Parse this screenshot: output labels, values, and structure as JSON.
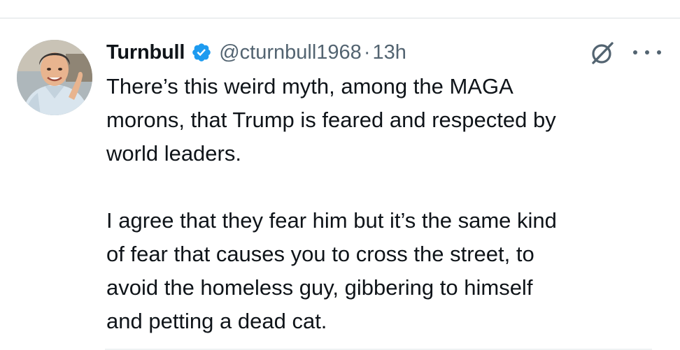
{
  "tweet": {
    "author": {
      "display_name": "Turnbull",
      "handle": "@cturnbull1968",
      "verified": true,
      "verified_color": "#1d9bf0"
    },
    "separator": "·",
    "timestamp": "13h",
    "paragraphs": [
      [
        "There’s this weird myth, among the MAGA",
        "morons, that Trump is feared and respected by",
        "world leaders."
      ],
      [
        "I agree that they fear him but it’s the same kind",
        "of fear that causes you to cross the street, to",
        "avoid the homeless guy, gibbering to himself",
        "and petting a dead cat."
      ]
    ]
  },
  "icons": {
    "verified": "verified-badge-icon",
    "grok": "grok-slash-icon",
    "more": "more-options-icon"
  }
}
